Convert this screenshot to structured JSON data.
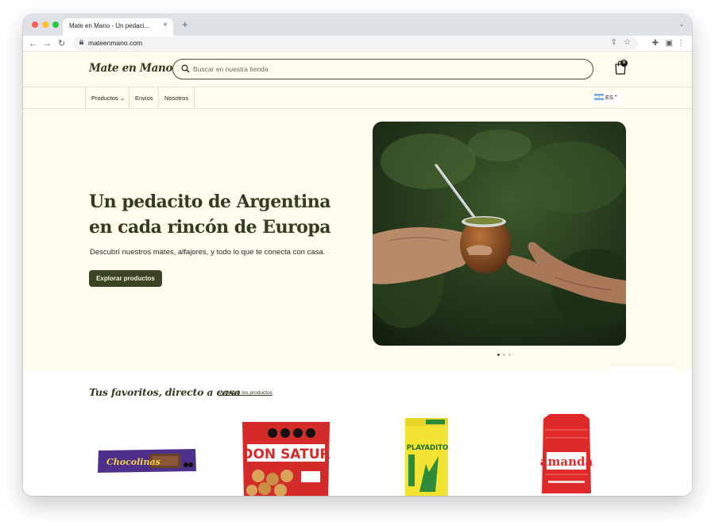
{
  "browser": {
    "tab_title": "Mate en Mano - Un pedaci...",
    "tab_close": "×",
    "new_tab": "+",
    "url": "mateenmano.com"
  },
  "site": {
    "logo": "Mate en Mano",
    "search": {
      "placeholder": "Buscar en nuestra tienda",
      "value": ""
    },
    "cart_count": "0",
    "nav": {
      "items": [
        {
          "label": "Productos"
        },
        {
          "label": "Envios"
        },
        {
          "label": "Nosotros"
        }
      ],
      "language": "ES"
    },
    "hero": {
      "title": "Un pedacito de Argentina en cada rincón de Europa",
      "subtitle": "Descubrí nuestros mates, alfajores, y todo lo que te conecta con casa.",
      "button": "Explorar productos",
      "slide": 1,
      "slide_count": 3
    },
    "favorites": {
      "title": "Tus favoritos, directo a casa",
      "link": "Ver todos los productos",
      "products": [
        {
          "image_text": "Chocolinas"
        },
        {
          "image_text": "DON SATUR"
        },
        {
          "image_text": "PLAYADITO"
        },
        {
          "image_text": "amanda"
        }
      ]
    }
  },
  "colors": {
    "page_background": "#fefcec",
    "brand_dark": "#353b20",
    "button": "#3a4324"
  }
}
